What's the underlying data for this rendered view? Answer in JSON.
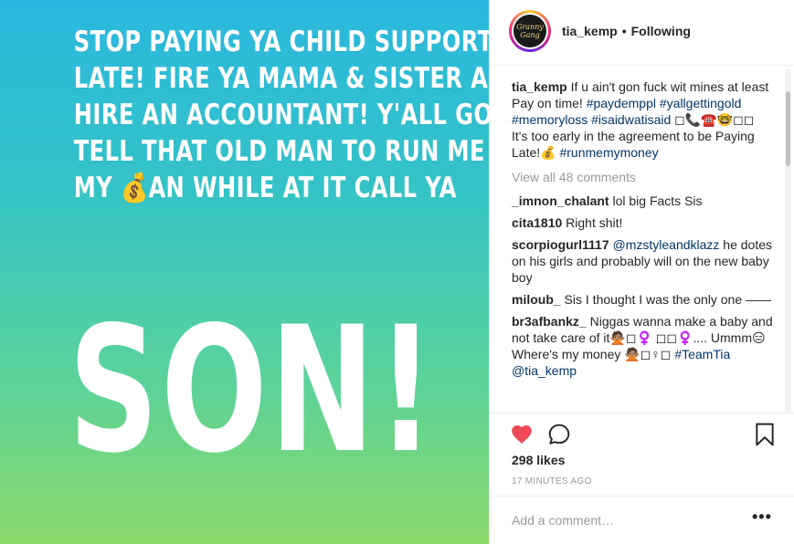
{
  "story": {
    "lines": [
      "STOP PAYING YA CHILD SUPPORT",
      "LATE! FIRE YA MAMA & SISTER AN",
      "HIRE AN ACCOUNTANT! Y'ALL GO",
      "TELL THAT OLD MAN TO RUN ME",
      "MY 💰AN WHILE AT IT CALL YA"
    ],
    "big_word": "SON!"
  },
  "header": {
    "avatar_text": "Granny Gang",
    "username": "tia_kemp",
    "separator": "•",
    "follow_status": "Following"
  },
  "caption": {
    "username": "tia_kemp",
    "text_1": " If u ain't gon fuck wit mines at least Pay on time! ",
    "tags_1": "#paydemppl #yallgettingold #memoryloss #isaidwatisaid",
    "text_2": " ◻📞☎️🤓◻◻ It's too early in the agreement to be Paying Late!💰 ",
    "tags_2": "#runmemymoney"
  },
  "view_all": "View all 48 comments",
  "comments": [
    {
      "username": "_imnon_chalant",
      "text": " lol big Facts Sis",
      "tag": ""
    },
    {
      "username": "cita1810",
      "text": " Right shit!",
      "tag": ""
    },
    {
      "username": "scorpiogurl1117",
      "text": " he dotes on his girls and probably will on the new baby boy",
      "tag": " @mzstyleandklazz"
    },
    {
      "username": "miloub_",
      "text": " Sis I thought I was the only one ——",
      "tag": ""
    },
    {
      "username": "br3afbankz_",
      "text": " Niggas wanna make a baby and not take care of it🙅🏽◻♀️ ◻◻♀️.... Ummm😑 Where's my money 🙅🏽◻♀◻ ",
      "tag": "#TeamTia @tia_kemp"
    }
  ],
  "likes": "298 likes",
  "timestamp": "17 MINUTES AGO",
  "add_comment_placeholder": "Add a comment…",
  "more_label": "•••",
  "colors": {
    "like": "#ed4956",
    "link": "#003569",
    "muted": "#999999"
  }
}
